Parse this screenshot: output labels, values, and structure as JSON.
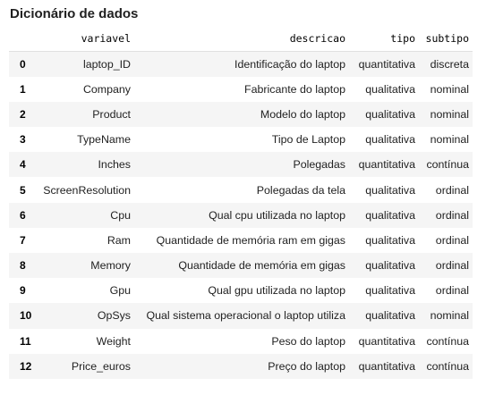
{
  "title": "Dicionário de dados",
  "table": {
    "columns": [
      "",
      "variavel",
      "descricao",
      "tipo",
      "subtipo"
    ],
    "rows": [
      {
        "index": "0",
        "variavel": "laptop_ID",
        "descricao": "Identificação do laptop",
        "tipo": "quantitativa",
        "subtipo": "discreta"
      },
      {
        "index": "1",
        "variavel": "Company",
        "descricao": "Fabricante do laptop",
        "tipo": "qualitativa",
        "subtipo": "nominal"
      },
      {
        "index": "2",
        "variavel": "Product",
        "descricao": "Modelo do laptop",
        "tipo": "qualitativa",
        "subtipo": "nominal"
      },
      {
        "index": "3",
        "variavel": "TypeName",
        "descricao": "Tipo de Laptop",
        "tipo": "qualitativa",
        "subtipo": "nominal"
      },
      {
        "index": "4",
        "variavel": "Inches",
        "descricao": "Polegadas",
        "tipo": "quantitativa",
        "subtipo": "contínua"
      },
      {
        "index": "5",
        "variavel": "ScreenResolution",
        "descricao": "Polegadas da tela",
        "tipo": "qualitativa",
        "subtipo": "ordinal"
      },
      {
        "index": "6",
        "variavel": "Cpu",
        "descricao": "Qual cpu utilizada no laptop",
        "tipo": "qualitativa",
        "subtipo": "ordinal"
      },
      {
        "index": "7",
        "variavel": "Ram",
        "descricao": "Quantidade de memória ram em gigas",
        "tipo": "qualitativa",
        "subtipo": "ordinal"
      },
      {
        "index": "8",
        "variavel": "Memory",
        "descricao": "Quantidade de memória em gigas",
        "tipo": "qualitativa",
        "subtipo": "ordinal"
      },
      {
        "index": "9",
        "variavel": "Gpu",
        "descricao": "Qual gpu utilizada no laptop",
        "tipo": "qualitativa",
        "subtipo": "ordinal"
      },
      {
        "index": "10",
        "variavel": "OpSys",
        "descricao": "Qual sistema operacional o laptop utiliza",
        "tipo": "qualitativa",
        "subtipo": "nominal"
      },
      {
        "index": "11",
        "variavel": "Weight",
        "descricao": "Peso do laptop",
        "tipo": "quantitativa",
        "subtipo": "contínua"
      },
      {
        "index": "12",
        "variavel": "Price_euros",
        "descricao": "Preço do laptop",
        "tipo": "quantitativa",
        "subtipo": "contínua"
      }
    ]
  },
  "colors": {
    "stripe": "#f5f5f5",
    "header_border": "#e0e0e0"
  }
}
